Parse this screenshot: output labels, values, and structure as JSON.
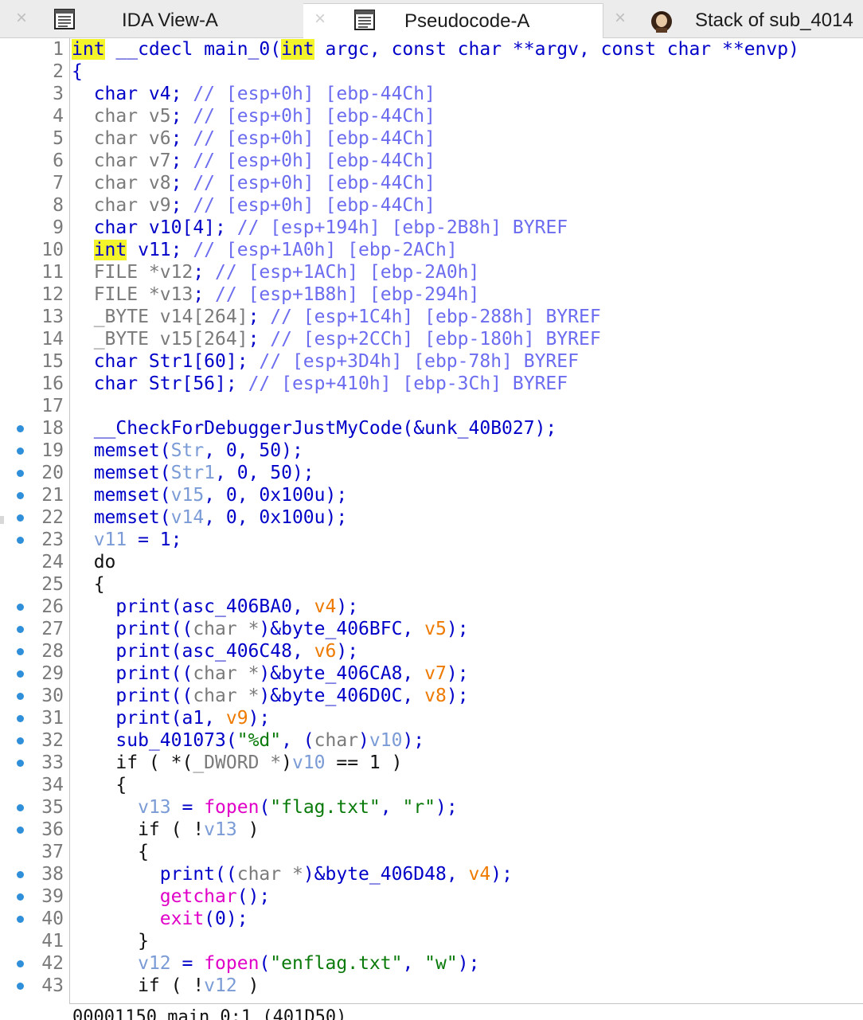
{
  "tabs": [
    {
      "label": "IDA View-A",
      "icon": "listing-view-icon",
      "close": "×",
      "active": true
    },
    {
      "label": "Pseudocode-A",
      "icon": "pseudocode-view-icon",
      "close": "×",
      "active": false
    },
    {
      "label": "Stack of sub_4014",
      "icon": "portrait-icon",
      "close": "×",
      "active": false
    }
  ],
  "breakpoint_lines": [
    18,
    19,
    20,
    21,
    22,
    23,
    26,
    27,
    28,
    29,
    30,
    31,
    32,
    33,
    35,
    36,
    38,
    39,
    40,
    42,
    43
  ],
  "code_lines": [
    {
      "n": "1",
      "tokens": [
        [
          "hl",
          "int"
        ],
        [
          "plain",
          " __cdecl main_0("
        ],
        [
          "hl",
          "int"
        ],
        [
          "plain",
          " argc, const char **argv, const char **envp)"
        ]
      ]
    },
    {
      "n": "2",
      "tokens": [
        [
          "plain",
          "{"
        ]
      ]
    },
    {
      "n": "3",
      "tokens": [
        [
          "plain",
          "  char v4; "
        ],
        [
          "comment",
          "// [esp+0h] [ebp-44Ch]"
        ]
      ]
    },
    {
      "n": "4",
      "tokens": [
        [
          "gray",
          "  char v5"
        ],
        [
          "plain",
          "; "
        ],
        [
          "comment",
          "// [esp+0h] [ebp-44Ch]"
        ]
      ]
    },
    {
      "n": "5",
      "tokens": [
        [
          "gray",
          "  char v6"
        ],
        [
          "plain",
          "; "
        ],
        [
          "comment",
          "// [esp+0h] [ebp-44Ch]"
        ]
      ]
    },
    {
      "n": "6",
      "tokens": [
        [
          "gray",
          "  char v7"
        ],
        [
          "plain",
          "; "
        ],
        [
          "comment",
          "// [esp+0h] [ebp-44Ch]"
        ]
      ]
    },
    {
      "n": "7",
      "tokens": [
        [
          "gray",
          "  char v8"
        ],
        [
          "plain",
          "; "
        ],
        [
          "comment",
          "// [esp+0h] [ebp-44Ch]"
        ]
      ]
    },
    {
      "n": "8",
      "tokens": [
        [
          "gray",
          "  char v9"
        ],
        [
          "plain",
          "; "
        ],
        [
          "comment",
          "// [esp+0h] [ebp-44Ch]"
        ]
      ]
    },
    {
      "n": "9",
      "tokens": [
        [
          "plain",
          "  char v10[4]; "
        ],
        [
          "comment",
          "// [esp+194h] [ebp-2B8h] BYREF"
        ]
      ]
    },
    {
      "n": "10",
      "tokens": [
        [
          "plain",
          "  "
        ],
        [
          "hl",
          "int"
        ],
        [
          "plain",
          " v11; "
        ],
        [
          "comment",
          "// [esp+1A0h] [ebp-2ACh]"
        ]
      ]
    },
    {
      "n": "11",
      "tokens": [
        [
          "gray",
          "  FILE *v12"
        ],
        [
          "plain",
          "; "
        ],
        [
          "comment",
          "// [esp+1ACh] [ebp-2A0h]"
        ]
      ]
    },
    {
      "n": "12",
      "tokens": [
        [
          "gray",
          "  FILE *v13"
        ],
        [
          "plain",
          "; "
        ],
        [
          "comment",
          "// [esp+1B8h] [ebp-294h]"
        ]
      ]
    },
    {
      "n": "13",
      "tokens": [
        [
          "gray",
          "  _BYTE v14[264]"
        ],
        [
          "plain",
          "; "
        ],
        [
          "comment",
          "// [esp+1C4h] [ebp-288h] BYREF"
        ]
      ]
    },
    {
      "n": "14",
      "tokens": [
        [
          "gray",
          "  _BYTE v15[264]"
        ],
        [
          "plain",
          "; "
        ],
        [
          "comment",
          "// [esp+2CCh] [ebp-180h] BYREF"
        ]
      ]
    },
    {
      "n": "15",
      "tokens": [
        [
          "plain",
          "  char Str1[60]; "
        ],
        [
          "comment",
          "// [esp+3D4h] [ebp-78h] BYREF"
        ]
      ]
    },
    {
      "n": "16",
      "tokens": [
        [
          "plain",
          "  char Str[56]; "
        ],
        [
          "comment",
          "// [esp+410h] [ebp-3Ch] BYREF"
        ]
      ]
    },
    {
      "n": "17",
      "tokens": []
    },
    {
      "n": "18",
      "tokens": [
        [
          "plain",
          "  __CheckForDebuggerJustMyCode(&unk_40B027);"
        ]
      ]
    },
    {
      "n": "19",
      "tokens": [
        [
          "plain",
          "  memset("
        ],
        [
          "var",
          "Str"
        ],
        [
          "plain",
          ", 0, 50);"
        ]
      ]
    },
    {
      "n": "20",
      "tokens": [
        [
          "plain",
          "  memset("
        ],
        [
          "var",
          "Str1"
        ],
        [
          "plain",
          ", 0, 50);"
        ]
      ]
    },
    {
      "n": "21",
      "tokens": [
        [
          "plain",
          "  memset("
        ],
        [
          "var",
          "v15"
        ],
        [
          "plain",
          ", 0, 0x100u);"
        ]
      ]
    },
    {
      "n": "22",
      "tokens": [
        [
          "plain",
          "  memset("
        ],
        [
          "var",
          "v14"
        ],
        [
          "plain",
          ", 0, 0x100u);"
        ]
      ]
    },
    {
      "n": "23",
      "tokens": [
        [
          "plain",
          "  "
        ],
        [
          "var",
          "v11"
        ],
        [
          "plain",
          " = 1;"
        ]
      ]
    },
    {
      "n": "24",
      "tokens": [
        [
          "black",
          "  do"
        ]
      ]
    },
    {
      "n": "25",
      "tokens": [
        [
          "black",
          "  {"
        ]
      ]
    },
    {
      "n": "26",
      "tokens": [
        [
          "plain",
          "    print(asc_406BA0, "
        ],
        [
          "arg",
          "v4"
        ],
        [
          "plain",
          ");"
        ]
      ]
    },
    {
      "n": "27",
      "tokens": [
        [
          "plain",
          "    print(("
        ],
        [
          "gray",
          "char *"
        ],
        [
          "plain",
          ")&byte_406BFC, "
        ],
        [
          "arg",
          "v5"
        ],
        [
          "plain",
          ");"
        ]
      ]
    },
    {
      "n": "28",
      "tokens": [
        [
          "plain",
          "    print(asc_406C48, "
        ],
        [
          "arg",
          "v6"
        ],
        [
          "plain",
          ");"
        ]
      ]
    },
    {
      "n": "29",
      "tokens": [
        [
          "plain",
          "    print(("
        ],
        [
          "gray",
          "char *"
        ],
        [
          "plain",
          ")&byte_406CA8, "
        ],
        [
          "arg",
          "v7"
        ],
        [
          "plain",
          ");"
        ]
      ]
    },
    {
      "n": "30",
      "tokens": [
        [
          "plain",
          "    print(("
        ],
        [
          "gray",
          "char *"
        ],
        [
          "plain",
          ")&byte_406D0C, "
        ],
        [
          "arg",
          "v8"
        ],
        [
          "plain",
          ");"
        ]
      ]
    },
    {
      "n": "31",
      "tokens": [
        [
          "plain",
          "    print(a1, "
        ],
        [
          "arg",
          "v9"
        ],
        [
          "plain",
          ");"
        ]
      ]
    },
    {
      "n": "32",
      "tokens": [
        [
          "plain",
          "    sub_401073("
        ],
        [
          "str",
          "\"%d\""
        ],
        [
          "plain",
          ", ("
        ],
        [
          "gray",
          "char"
        ],
        [
          "plain",
          ")"
        ],
        [
          "var",
          "v10"
        ],
        [
          "plain",
          ");"
        ]
      ]
    },
    {
      "n": "33",
      "tokens": [
        [
          "black",
          "    if ( *("
        ],
        [
          "gray",
          "_DWORD *"
        ],
        [
          "black",
          ")"
        ],
        [
          "var",
          "v10"
        ],
        [
          "black",
          " == 1 )"
        ]
      ]
    },
    {
      "n": "34",
      "tokens": [
        [
          "black",
          "    {"
        ]
      ]
    },
    {
      "n": "35",
      "tokens": [
        [
          "plain",
          "      "
        ],
        [
          "var",
          "v13"
        ],
        [
          "plain",
          " = "
        ],
        [
          "imp",
          "fopen"
        ],
        [
          "plain",
          "("
        ],
        [
          "str",
          "\"flag.txt\""
        ],
        [
          "plain",
          ", "
        ],
        [
          "str",
          "\"r\""
        ],
        [
          "plain",
          ");"
        ]
      ]
    },
    {
      "n": "36",
      "tokens": [
        [
          "black",
          "      if ( !"
        ],
        [
          "var",
          "v13"
        ],
        [
          "black",
          " )"
        ]
      ]
    },
    {
      "n": "37",
      "tokens": [
        [
          "black",
          "      {"
        ]
      ]
    },
    {
      "n": "38",
      "tokens": [
        [
          "plain",
          "        print(("
        ],
        [
          "gray",
          "char *"
        ],
        [
          "plain",
          ")&byte_406D48, "
        ],
        [
          "arg",
          "v4"
        ],
        [
          "plain",
          ");"
        ]
      ]
    },
    {
      "n": "39",
      "tokens": [
        [
          "plain",
          "        "
        ],
        [
          "imp",
          "getchar"
        ],
        [
          "plain",
          "();"
        ]
      ]
    },
    {
      "n": "40",
      "tokens": [
        [
          "plain",
          "        "
        ],
        [
          "imp",
          "exit"
        ],
        [
          "plain",
          "(0);"
        ]
      ]
    },
    {
      "n": "41",
      "tokens": [
        [
          "black",
          "      }"
        ]
      ]
    },
    {
      "n": "42",
      "tokens": [
        [
          "plain",
          "      "
        ],
        [
          "var",
          "v12"
        ],
        [
          "plain",
          " = "
        ],
        [
          "imp",
          "fopen"
        ],
        [
          "plain",
          "("
        ],
        [
          "str",
          "\"enflag.txt\""
        ],
        [
          "plain",
          ", "
        ],
        [
          "str",
          "\"w\""
        ],
        [
          "plain",
          ");"
        ]
      ]
    },
    {
      "n": "43",
      "tokens": [
        [
          "black",
          "      if ( !"
        ],
        [
          "var",
          "v12"
        ],
        [
          "black",
          " )"
        ]
      ]
    }
  ],
  "status": {
    "text": "00001150 main_0:1 (401D50)"
  },
  "colors": {
    "keyword_highlight": "#f4f42a",
    "code_default": "#0000c8",
    "comment": "#6c6cf0",
    "variable": "#7a9bd6",
    "string": "#0a7a0a",
    "import_call": "#e000c8",
    "argument": "#ee7a00",
    "breakpoint_dot": "#2f8fd8"
  }
}
